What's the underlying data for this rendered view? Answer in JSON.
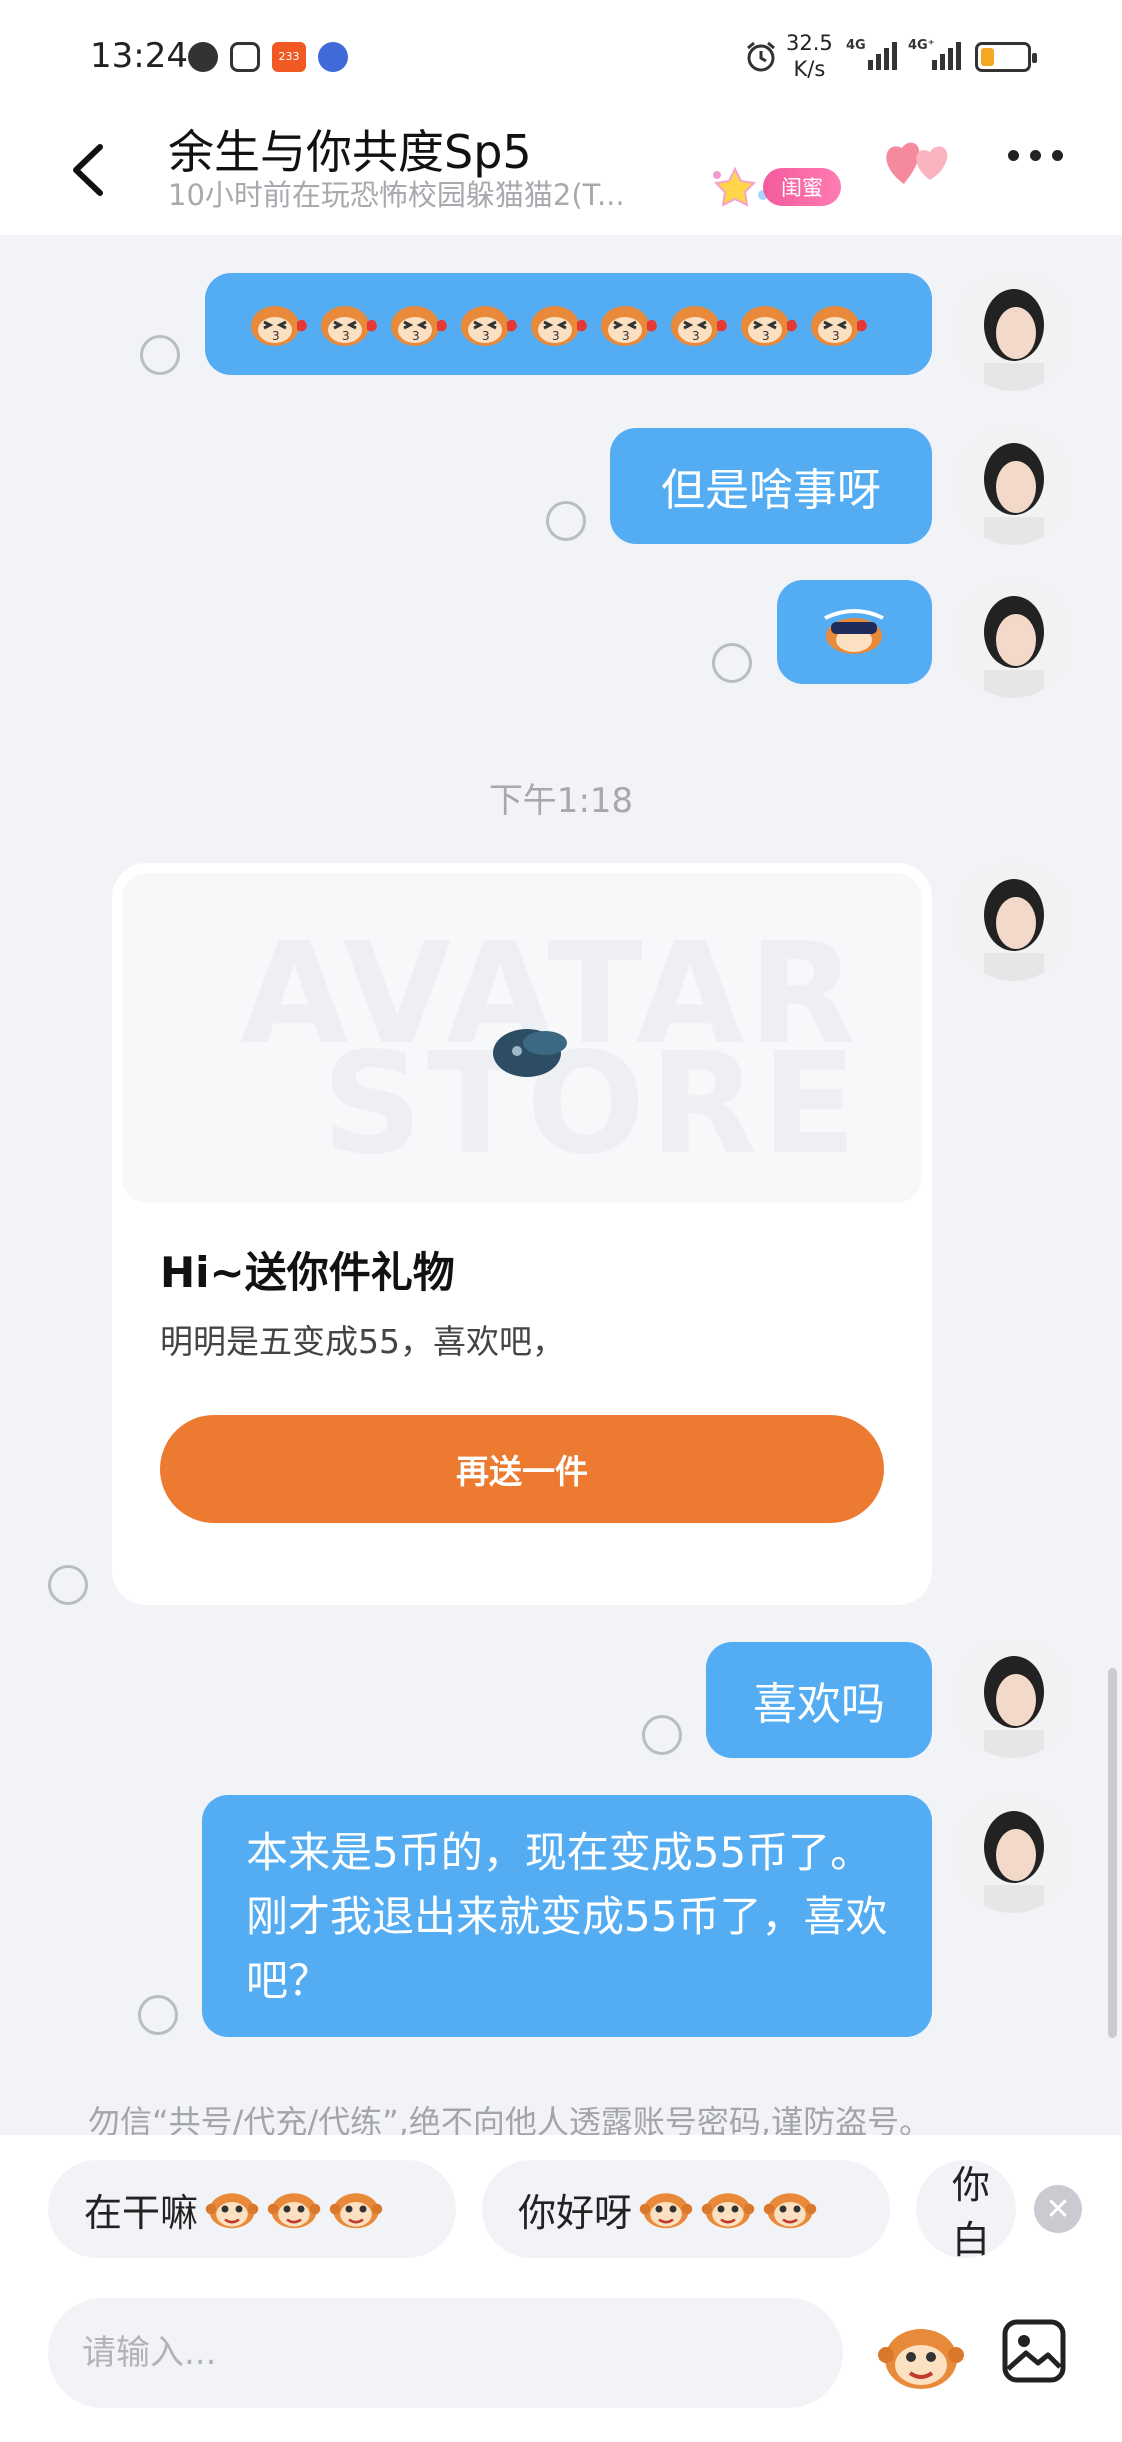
{
  "status_bar": {
    "time": "13:24",
    "app_badge": "233",
    "net_speed_value": "32.5",
    "net_speed_unit": "K/s",
    "network_1": "4G",
    "network_2": "4G⁺",
    "battery_percent": 30
  },
  "header": {
    "title": "余生与你共度Sp5",
    "subtitle": "10小时前在玩恐怖校园躲猫猫2(T...",
    "relation_badge": "闺蜜"
  },
  "messages": {
    "time_separator": "下午1:18",
    "bubble_2": "但是啥事呀",
    "bubble_4": "喜欢吗",
    "bubble_5": "本来是5币的，现在变成55币了。刚才我退出来就变成55币了，喜欢吧？"
  },
  "gift_card": {
    "watermark_line1": "AVATAR",
    "watermark_line2": "STORE",
    "title": "Hi~送你件礼物",
    "message": "明明是五变成55，喜欢吧，",
    "button_label": "再送一件"
  },
  "notice": "勿信“共号/代充/代练”,绝不向他人透露账号密码,谨防盗号。",
  "quick_replies": [
    {
      "label": "在干嘛"
    },
    {
      "label": "你好呀"
    },
    {
      "label": "你白"
    }
  ],
  "composer": {
    "placeholder": "请输入..."
  },
  "colors": {
    "bubble": "#54adf2",
    "gift_button": "#ed7a31",
    "badge": "#f45b9d"
  },
  "icons": [
    "back-arrow-icon",
    "more-icon",
    "hearts-icon",
    "monkey-sticker-icon",
    "image-icon",
    "close-icon"
  ]
}
